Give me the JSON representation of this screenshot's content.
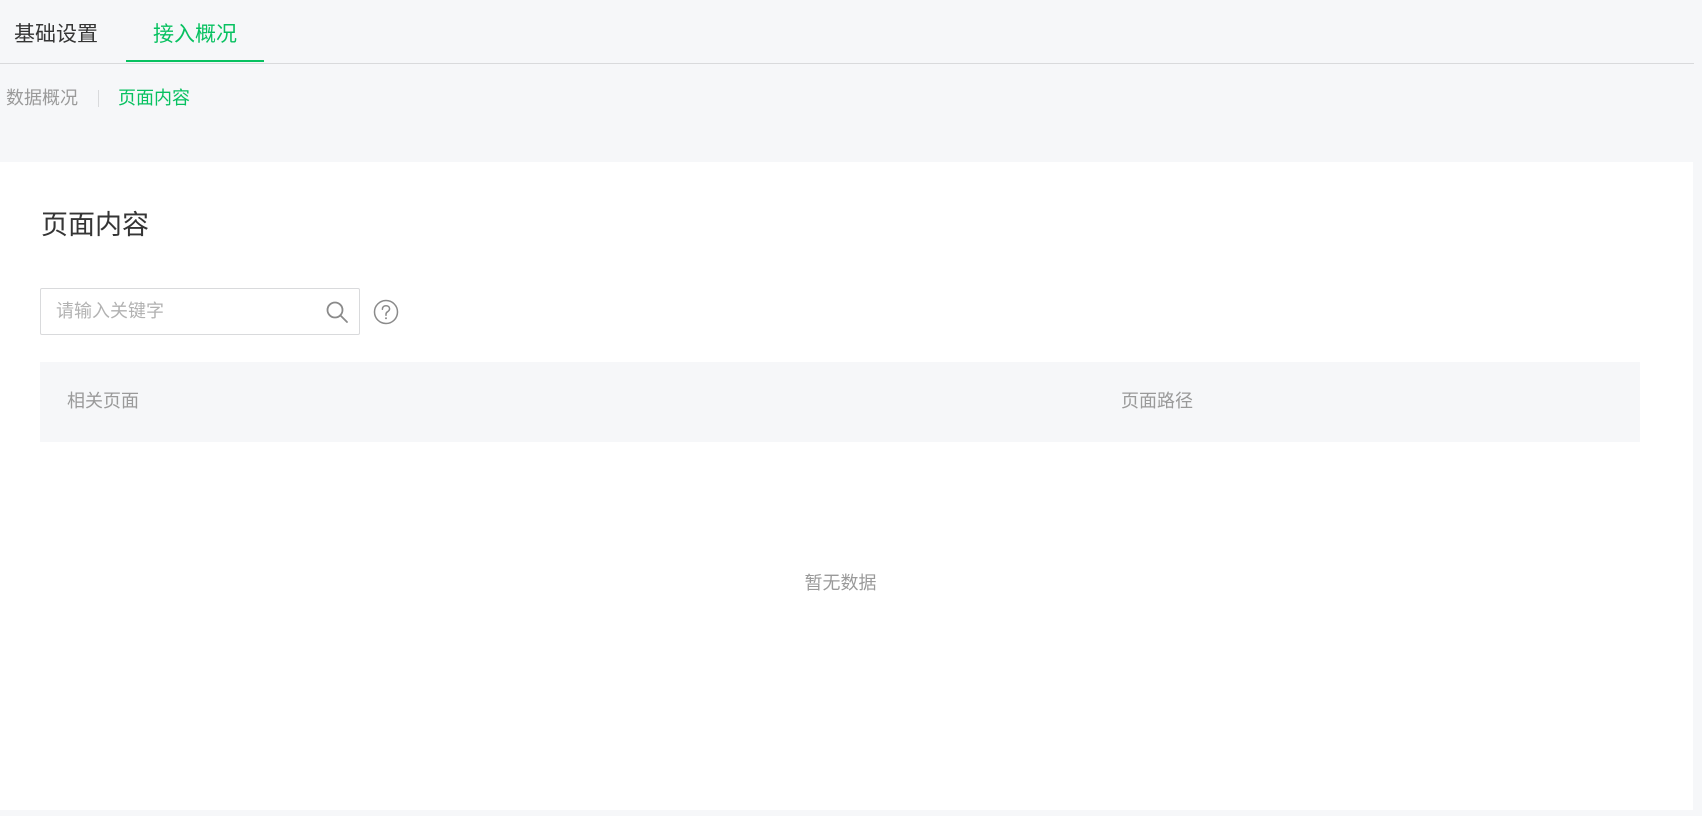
{
  "top_tabs": {
    "basic_settings": "基础设置",
    "access_overview": "接入概况"
  },
  "sub_nav": {
    "data_overview": "数据概况",
    "page_content": "页面内容"
  },
  "main": {
    "title": "页面内容",
    "search": {
      "placeholder": "请输入关键字",
      "value": ""
    },
    "table": {
      "columns": [
        "相关页面",
        "页面路径"
      ],
      "rows": [],
      "empty_text": "暂无数据"
    }
  },
  "icons": {
    "search": "search-icon",
    "help": "help-icon"
  },
  "colors": {
    "accent": "#07c160",
    "page_background": "#f6f7f9",
    "panel_background": "#ffffff",
    "muted_text": "#9a9a9a",
    "primary_text": "#353535"
  }
}
